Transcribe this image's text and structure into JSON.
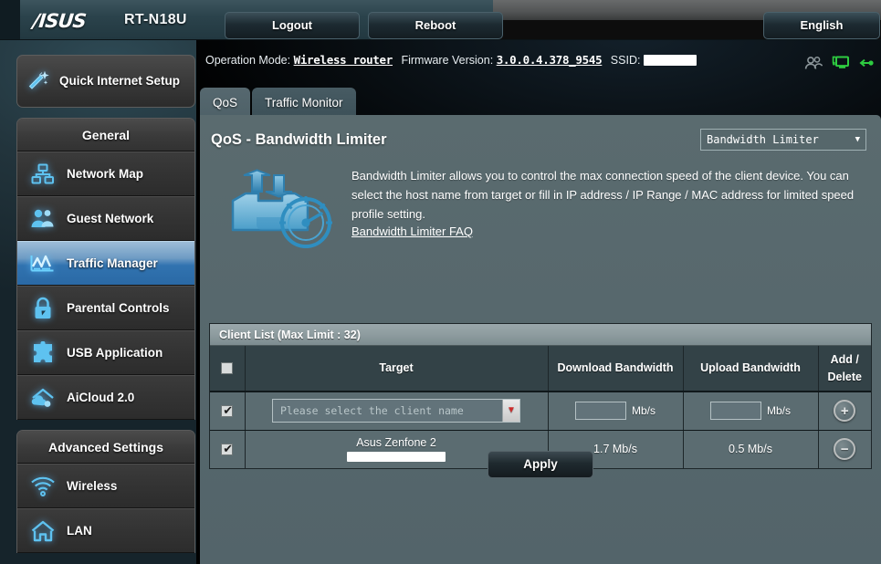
{
  "header": {
    "brand": "/ISUS",
    "model": "RT-N18U",
    "logout_label": "Logout",
    "reboot_label": "Reboot",
    "language_label": "English"
  },
  "info": {
    "operation_mode_label": "Operation Mode:",
    "operation_mode_value": "Wireless router",
    "firmware_label": "Firmware Version:",
    "firmware_value": "3.0.0.4.378_9545",
    "ssid_label": "SSID:",
    "ssid_value": "",
    "icons": [
      "users-icon",
      "client-monitor-icon",
      "usb-link-icon"
    ]
  },
  "sidebar": {
    "quick_setup": {
      "label": "Quick Internet Setup",
      "icon": "magic-wand-icon"
    },
    "groups": [
      {
        "title": "General",
        "items": [
          {
            "label": "Network Map",
            "icon": "network-map-icon",
            "active": false
          },
          {
            "label": "Guest Network",
            "icon": "guest-network-icon",
            "active": false
          },
          {
            "label": "Traffic Manager",
            "icon": "traffic-manager-icon",
            "active": true
          },
          {
            "label": "Parental Controls",
            "icon": "lock-icon",
            "active": false
          },
          {
            "label": "USB Application",
            "icon": "puzzle-icon",
            "active": false
          },
          {
            "label": "AiCloud 2.0",
            "icon": "aicloud-icon",
            "active": false
          }
        ]
      },
      {
        "title": "Advanced Settings",
        "items": [
          {
            "label": "Wireless",
            "icon": "wifi-icon",
            "active": false
          },
          {
            "label": "LAN",
            "icon": "home-icon",
            "active": false
          }
        ]
      }
    ]
  },
  "content": {
    "tabs": [
      {
        "label": "QoS",
        "active": true
      },
      {
        "label": "Traffic Monitor",
        "active": false
      }
    ],
    "page_title": "QoS - Bandwidth Limiter",
    "mode_select": {
      "value": "Bandwidth Limiter",
      "caret": "▼",
      "options": [
        "Bandwidth Limiter"
      ]
    },
    "description": {
      "icon": "bandwidth-speedometer-icon",
      "paragraph": "Bandwidth Limiter allows you to control the max connection speed of the client device. You can select the host name from target or fill in IP address / IP Range / MAC address for limited speed profile setting.",
      "faq_link": "Bandwidth Limiter FAQ"
    },
    "table": {
      "caption": "Client List (Max Limit : 32)",
      "columns": [
        "",
        "Target",
        "Download Bandwidth",
        "Upload Bandwidth",
        "Add / Delete"
      ],
      "header_checkbox_checked": false,
      "rows": [
        {
          "checked": true,
          "type": "new",
          "target_placeholder": "Please select the client name",
          "dropdown_caret": "▼",
          "download_value": "",
          "upload_value": "",
          "unit": "Mb/s",
          "action_icon": "plus-circle-icon",
          "action_glyph": "+"
        },
        {
          "checked": true,
          "type": "existing",
          "target_name": "Asus Zenfone 2",
          "target_mac": "",
          "download_value": "1.7 Mb/s",
          "upload_value": "0.5 Mb/s",
          "action_icon": "minus-circle-icon",
          "action_glyph": "−"
        }
      ]
    },
    "apply_label": "Apply"
  },
  "colors": {
    "accent_blue": "#2a69a5",
    "panel_bg": "#57686c",
    "table_row_bg": "#5b6c71",
    "table_header_bg": "#334247",
    "icon_blue": "#56b8f0",
    "green_status": "#2ecc40"
  }
}
